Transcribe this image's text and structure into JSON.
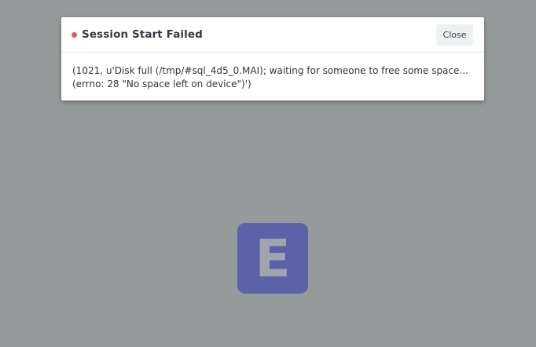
{
  "dialog": {
    "title": "Session Start Failed",
    "close_label": "Close",
    "message_lines": [
      "(1021, u'Disk full (/tmp/#sql_4d5_0.MAI); waiting for someone to free some space...",
      "(errno: 28 \"No space left on device\")')"
    ],
    "status_color": "#e8585a"
  },
  "logo": {
    "letter": "E",
    "background_color": "#5b62a8"
  },
  "colors": {
    "background": "#959b9b"
  }
}
